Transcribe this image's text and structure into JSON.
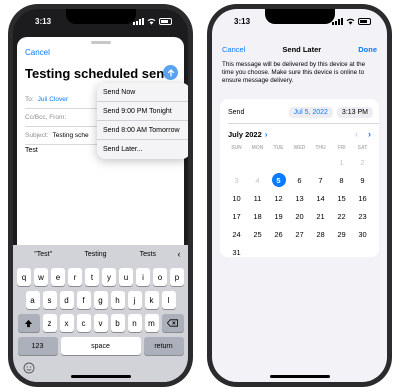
{
  "left": {
    "status_time": "3:13",
    "cancel": "Cancel",
    "subject_title": "Testing scheduled send",
    "to_label": "To:",
    "to_value": "Juli Clover",
    "ccbcc_label": "Cc/Bcc, From:",
    "subject_label": "Subject:",
    "subject_value": "Testing sche",
    "body": "Test",
    "menu": [
      "Send Now",
      "Send 9:00 PM Tonight",
      "Send 8:00 AM Tomorrow",
      "Send Later..."
    ],
    "suggestions": [
      "\"Test\"",
      "Testing",
      "Tests"
    ],
    "keys_row1": [
      "q",
      "w",
      "e",
      "r",
      "t",
      "y",
      "u",
      "i",
      "o",
      "p"
    ],
    "keys_row2": [
      "a",
      "s",
      "d",
      "f",
      "g",
      "h",
      "j",
      "k",
      "l"
    ],
    "keys_row3": [
      "z",
      "x",
      "c",
      "v",
      "b",
      "n",
      "m"
    ],
    "num_key": "123",
    "space_key": "space",
    "return_key": "return"
  },
  "right": {
    "status_time": "3:13",
    "cancel": "Cancel",
    "title": "Send Later",
    "done": "Done",
    "info": "This message will be delivered by this device at the time you choose. Make sure this device is online to ensure message delivery.",
    "send_label": "Send",
    "date_value": "Jul 5, 2022",
    "time_value": "3:13 PM",
    "month": "July 2022",
    "weekdays": [
      "SUN",
      "MON",
      "TUE",
      "WED",
      "THU",
      "FRI",
      "SAT"
    ],
    "weeks": [
      [
        "",
        "",
        "",
        "",
        "",
        "1",
        "2"
      ],
      [
        "3",
        "4",
        "5",
        "6",
        "7",
        "8",
        "9"
      ],
      [
        "10",
        "11",
        "12",
        "13",
        "14",
        "15",
        "16"
      ],
      [
        "17",
        "18",
        "19",
        "20",
        "21",
        "22",
        "23"
      ],
      [
        "24",
        "25",
        "26",
        "27",
        "28",
        "29",
        "30"
      ],
      [
        "31",
        "",
        "",
        "",
        "",
        "",
        ""
      ]
    ],
    "selected_day": "5",
    "past_days": [
      "1",
      "2",
      "3",
      "4"
    ]
  },
  "colors": {
    "accent": "#0a7aff",
    "keyboard": "#d1d3d9"
  }
}
